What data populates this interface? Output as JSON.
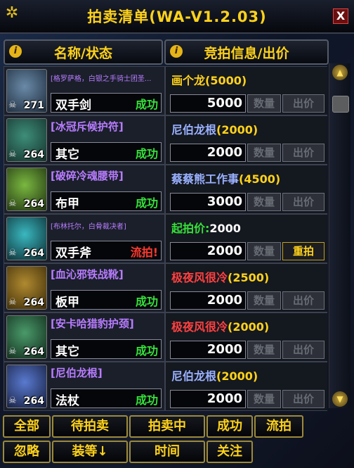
{
  "window": {
    "title": "拍卖清单(WA-V1.2.03)",
    "close_label": "X"
  },
  "headers": {
    "name": "名称/状态",
    "bid": "竞拍信息/出价",
    "info_glyph": "i"
  },
  "buttons": {
    "qty": "数量",
    "bid": "出价",
    "rebid": "重拍"
  },
  "colors": {
    "success": "#36e13a",
    "fail": "#ff3a2e",
    "gold": "#ffd21a",
    "purple": "#b87cff",
    "blue_name": "#9ab1ff",
    "red_name": "#ff4040",
    "green_name": "#36e13a"
  },
  "items": [
    {
      "name": "[格罗萨格，白银之手骑士团圣...",
      "name_color": "#b87cff",
      "small": true,
      "type": "双手剑",
      "status": "成功",
      "status_color": "#36e13a",
      "level": "271",
      "bidder": "画个龙",
      "bidder_color": "#ffd21a",
      "amount": "(5000)",
      "price": "5000",
      "action": "出价",
      "icon": "sword-icon",
      "icon_colors": [
        "#6a8aa8",
        "#1c2a3a"
      ]
    },
    {
      "name": "[冰冠斥候护符]",
      "name_color": "#b87cff",
      "small": false,
      "type": "其它",
      "status": "成功",
      "status_color": "#36e13a",
      "level": "264",
      "bidder": "尼伯龙根",
      "bidder_color": "#9ab1ff",
      "amount": "(2000)",
      "price": "2000",
      "action": "出价",
      "icon": "amulet-icon",
      "icon_colors": [
        "#3e8e7a",
        "#14302a"
      ]
    },
    {
      "name": "[破碎冷魂腰带]",
      "name_color": "#b87cff",
      "small": false,
      "type": "布甲",
      "status": "成功",
      "status_color": "#36e13a",
      "level": "264",
      "bidder": "蔡蔡熊工作事",
      "bidder_color": "#9ab1ff",
      "amount": "(4500)",
      "price": "3000",
      "action": "出价",
      "icon": "belt-icon",
      "icon_colors": [
        "#7ab840",
        "#1e3010"
      ]
    },
    {
      "name": "[布林托尔，白骨裁决者]",
      "name_color": "#b87cff",
      "small": true,
      "type": "双手斧",
      "status": "流拍!",
      "status_color": "#ff3a2e",
      "level": "264",
      "bidder": "起拍价:",
      "bidder_color": "#36e13a",
      "amount": "2000",
      "amount_color": "#ffffff",
      "price": "2000",
      "action": "重拍",
      "action_active": true,
      "icon": "axe-icon",
      "icon_colors": [
        "#3ab8c0",
        "#0c2a30"
      ]
    },
    {
      "name": "[血沁邪铁战靴]",
      "name_color": "#b87cff",
      "small": false,
      "type": "板甲",
      "status": "成功",
      "status_color": "#36e13a",
      "level": "264",
      "bidder": "极夜风很冷",
      "bidder_color": "#ff4040",
      "amount": "(2500)",
      "price": "2000",
      "action": "出价",
      "icon": "boots-icon",
      "icon_colors": [
        "#b08a30",
        "#3a2a08"
      ]
    },
    {
      "name": "[安卡哈猎豹护颈]",
      "name_color": "#b87cff",
      "small": false,
      "type": "其它",
      "status": "成功",
      "status_color": "#36e13a",
      "level": "264",
      "bidder": "极夜风很冷",
      "bidder_color": "#ff4040",
      "amount": "(2000)",
      "price": "2000",
      "action": "出价",
      "icon": "necklace-icon",
      "icon_colors": [
        "#4a9a6a",
        "#10281a"
      ]
    },
    {
      "name": "[尼伯龙根]",
      "name_color": "#b87cff",
      "small": false,
      "type": "法杖",
      "status": "成功",
      "status_color": "#36e13a",
      "level": "264",
      "bidder": "尼伯龙根",
      "bidder_color": "#9ab1ff",
      "amount": "(2000)",
      "price": "2000",
      "action": "出价",
      "icon": "staff-icon",
      "icon_colors": [
        "#5a7ad0",
        "#141c3a"
      ]
    }
  ],
  "filters": [
    "全部",
    "待拍卖",
    "拍卖中",
    "成功",
    "流拍",
    "忽略",
    "装等↓",
    "时间",
    "关注"
  ],
  "scroll": {
    "up_icon": "scroll-up-icon",
    "down_icon": "scroll-down-icon"
  }
}
